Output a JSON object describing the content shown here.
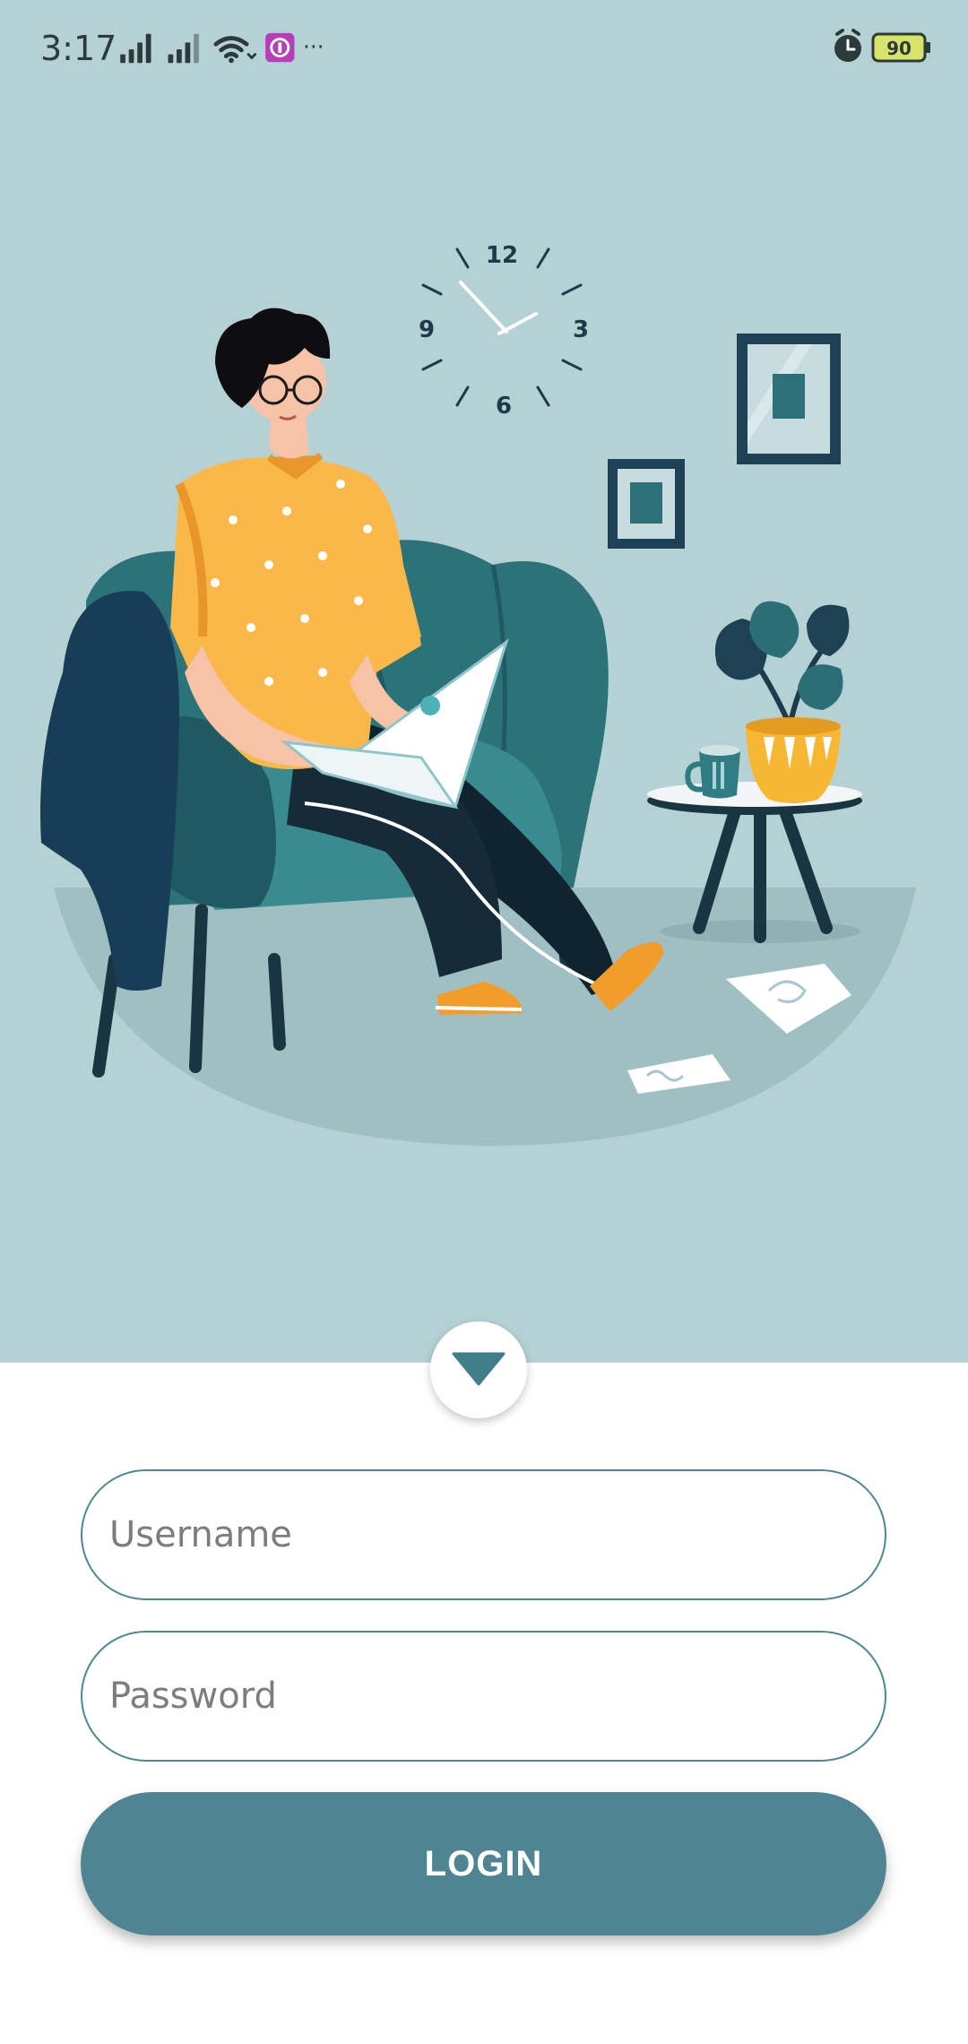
{
  "status_bar": {
    "time": "3:17",
    "battery_level": "90",
    "more_indicator": "···",
    "icons": [
      "signal-icon",
      "signal-icon",
      "wifi-icon",
      "app-notification-icon",
      "more-icon",
      "alarm-icon",
      "battery-icon"
    ]
  },
  "illustration": {
    "description_icon": "person-working-on-laptop-illustration",
    "clock_numbers": {
      "twelve": "12",
      "three": "3",
      "six": "6",
      "nine": "9"
    }
  },
  "form": {
    "toggle_icon": "chevron-down-icon",
    "username": {
      "placeholder": "Username",
      "value": ""
    },
    "password": {
      "placeholder": "Password",
      "value": ""
    },
    "login_label": "LOGIN"
  },
  "colors": {
    "hero_background": "#b5d1d4",
    "accent": "#4f8592",
    "field_border": "#4f8792",
    "background": "#ffffff"
  }
}
